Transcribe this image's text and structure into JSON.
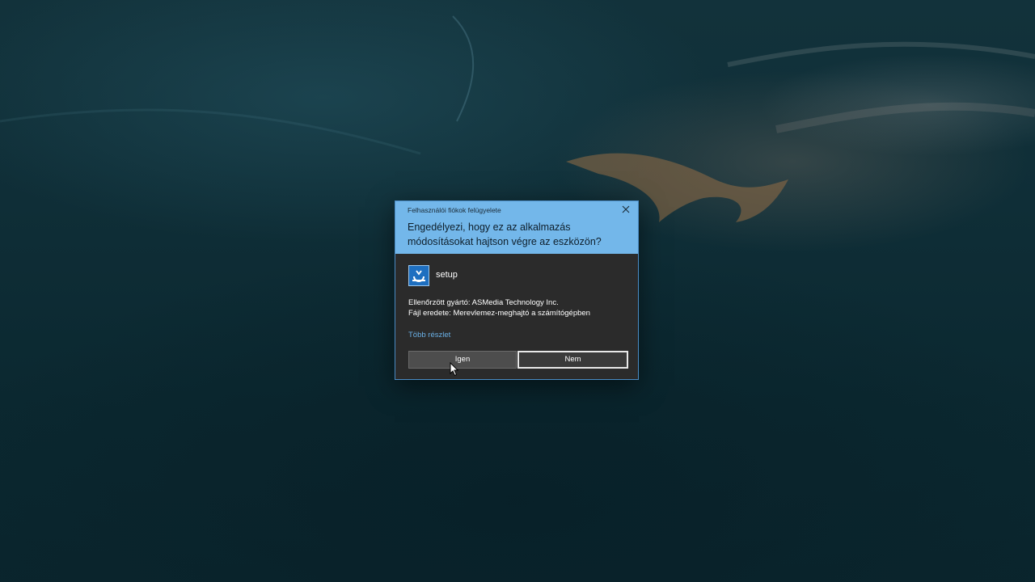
{
  "dialog": {
    "caption": "Felhasználói fiókok felügyelete",
    "close_icon": "close-icon",
    "question": "Engedélyezi, hogy ez az alkalmazás módosításokat hajtson végre az eszközön?",
    "app_icon": "setup-installer-icon",
    "app_name": "setup",
    "publisher_line": "Ellenőrzött gyártó: ASMedia Technology Inc.",
    "origin_line": "Fájl eredete: Merevlemez-meghajtó a számítógépben",
    "more_details": "Több részlet",
    "yes_label": "Igen",
    "no_label": "Nem"
  },
  "colors": {
    "header_bg": "#73b7ea",
    "body_bg": "#2b2b2b",
    "link": "#6ab0e6",
    "desktop_bg": "#0f2e37"
  }
}
